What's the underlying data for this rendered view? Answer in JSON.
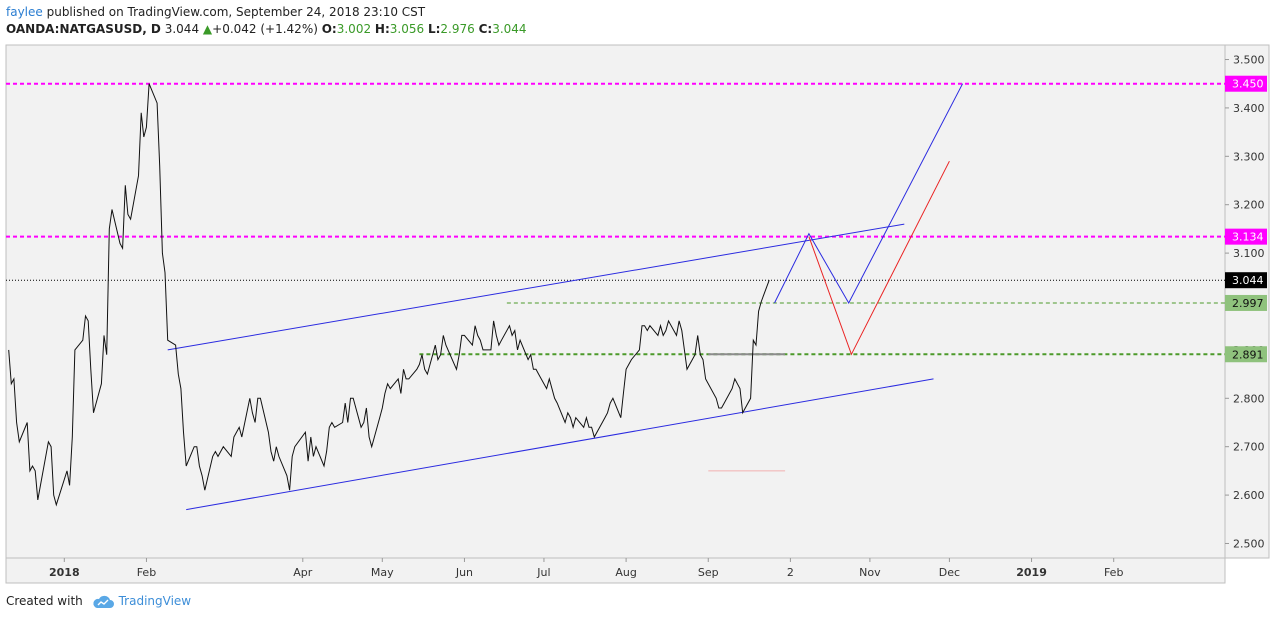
{
  "header": {
    "author": "faylee",
    "published_text": " published on TradingView.com, September 24, 2018 23:10 CST",
    "symbol": "OANDA:NATGASUSD, D",
    "last": "3.044",
    "change_icon": "triangle-up-icon",
    "change": "+0.042 (+1.42%)",
    "open_label": "O:",
    "open": "3.002",
    "high_label": "H:",
    "high": "3.056",
    "low_label": "L:",
    "low": "2.976",
    "close_label": "C:",
    "close": "3.044"
  },
  "footer": {
    "created_with": "Created with",
    "brand": "TradingView",
    "brand_icon": "tradingview-cloud-icon"
  },
  "colors": {
    "plot_bg": "#f2f2f2",
    "price_line": "#111111",
    "channel": "#2b2be0",
    "projection_blue": "#2b2be0",
    "projection_red": "#ea2323",
    "resistance": "#ff00ff",
    "support": "#4c9a2a",
    "support_label_bg": "#8fc27d",
    "current_price_bg": "#000000"
  },
  "chart_data": {
    "type": "line",
    "title": "",
    "xlabel": "",
    "ylabel": "",
    "ylim": [
      2.47,
      3.53
    ],
    "y_ticks": [
      "2.500",
      "2.600",
      "2.700",
      "2.800",
      "2.900",
      "3.000",
      "3.100",
      "3.200",
      "3.300",
      "3.400",
      "3.500"
    ],
    "x_ticks": [
      {
        "label": "2018",
        "date": "2018-01-01",
        "bold": true
      },
      {
        "label": "Feb",
        "date": "2018-02-01"
      },
      {
        "label": "Apr",
        "date": "2018-04-01"
      },
      {
        "label": "May",
        "date": "2018-05-01"
      },
      {
        "label": "Jun",
        "date": "2018-06-01"
      },
      {
        "label": "Jul",
        "date": "2018-07-01"
      },
      {
        "label": "Aug",
        "date": "2018-08-01"
      },
      {
        "label": "Sep",
        "date": "2018-09-01"
      },
      {
        "label": "2",
        "date": "2018-10-02"
      },
      {
        "label": "Nov",
        "date": "2018-11-01"
      },
      {
        "label": "Dec",
        "date": "2018-12-01"
      },
      {
        "label": "2019",
        "date": "2019-01-01",
        "bold": true
      },
      {
        "label": "Feb",
        "date": "2019-02-01"
      }
    ],
    "x_range": [
      "2017-12-10",
      "2019-03-15"
    ],
    "series": [
      {
        "values": [
          [
            "2017-12-11",
            2.9
          ],
          [
            "2017-12-12",
            2.83
          ],
          [
            "2017-12-13",
            2.84
          ],
          [
            "2017-12-14",
            2.75
          ],
          [
            "2017-12-15",
            2.71
          ],
          [
            "2017-12-18",
            2.75
          ],
          [
            "2017-12-19",
            2.65
          ],
          [
            "2017-12-20",
            2.66
          ],
          [
            "2017-12-21",
            2.65
          ],
          [
            "2017-12-22",
            2.59
          ],
          [
            "2017-12-26",
            2.71
          ],
          [
            "2017-12-27",
            2.7
          ],
          [
            "2017-12-28",
            2.6
          ],
          [
            "2017-12-29",
            2.58
          ],
          [
            "2018-01-02",
            2.65
          ],
          [
            "2018-01-03",
            2.62
          ],
          [
            "2018-01-04",
            2.72
          ],
          [
            "2018-01-05",
            2.9
          ],
          [
            "2018-01-08",
            2.92
          ],
          [
            "2018-01-09",
            2.97
          ],
          [
            "2018-01-10",
            2.96
          ],
          [
            "2018-01-11",
            2.86
          ],
          [
            "2018-01-12",
            2.77
          ],
          [
            "2018-01-15",
            2.83
          ],
          [
            "2018-01-16",
            2.93
          ],
          [
            "2018-01-17",
            2.89
          ],
          [
            "2018-01-18",
            3.15
          ],
          [
            "2018-01-19",
            3.19
          ],
          [
            "2018-01-22",
            3.12
          ],
          [
            "2018-01-23",
            3.11
          ],
          [
            "2018-01-24",
            3.24
          ],
          [
            "2018-01-25",
            3.18
          ],
          [
            "2018-01-26",
            3.17
          ],
          [
            "2018-01-29",
            3.26
          ],
          [
            "2018-01-30",
            3.39
          ],
          [
            "2018-01-31",
            3.34
          ],
          [
            "2018-02-01",
            3.36
          ],
          [
            "2018-02-02",
            3.45
          ],
          [
            "2018-02-05",
            3.41
          ],
          [
            "2018-02-06",
            3.28
          ],
          [
            "2018-02-07",
            3.1
          ],
          [
            "2018-02-08",
            3.06
          ],
          [
            "2018-02-09",
            2.92
          ],
          [
            "2018-02-12",
            2.91
          ],
          [
            "2018-02-13",
            2.85
          ],
          [
            "2018-02-14",
            2.82
          ],
          [
            "2018-02-15",
            2.73
          ],
          [
            "2018-02-16",
            2.66
          ],
          [
            "2018-02-19",
            2.7
          ],
          [
            "2018-02-20",
            2.7
          ],
          [
            "2018-02-21",
            2.66
          ],
          [
            "2018-02-22",
            2.64
          ],
          [
            "2018-02-23",
            2.61
          ],
          [
            "2018-02-26",
            2.68
          ],
          [
            "2018-02-27",
            2.69
          ],
          [
            "2018-02-28",
            2.68
          ],
          [
            "2018-03-01",
            2.69
          ],
          [
            "2018-03-02",
            2.7
          ],
          [
            "2018-03-05",
            2.68
          ],
          [
            "2018-03-06",
            2.72
          ],
          [
            "2018-03-07",
            2.73
          ],
          [
            "2018-03-08",
            2.74
          ],
          [
            "2018-03-09",
            2.72
          ],
          [
            "2018-03-12",
            2.8
          ],
          [
            "2018-03-13",
            2.77
          ],
          [
            "2018-03-14",
            2.75
          ],
          [
            "2018-03-15",
            2.8
          ],
          [
            "2018-03-16",
            2.8
          ],
          [
            "2018-03-19",
            2.73
          ],
          [
            "2018-03-20",
            2.69
          ],
          [
            "2018-03-21",
            2.67
          ],
          [
            "2018-03-22",
            2.7
          ],
          [
            "2018-03-23",
            2.68
          ],
          [
            "2018-03-26",
            2.64
          ],
          [
            "2018-03-27",
            2.61
          ],
          [
            "2018-03-28",
            2.68
          ],
          [
            "2018-03-29",
            2.7
          ],
          [
            "2018-04-02",
            2.73
          ],
          [
            "2018-04-03",
            2.67
          ],
          [
            "2018-04-04",
            2.72
          ],
          [
            "2018-04-05",
            2.68
          ],
          [
            "2018-04-06",
            2.7
          ],
          [
            "2018-04-09",
            2.66
          ],
          [
            "2018-04-10",
            2.69
          ],
          [
            "2018-04-11",
            2.74
          ],
          [
            "2018-04-12",
            2.75
          ],
          [
            "2018-04-13",
            2.74
          ],
          [
            "2018-04-16",
            2.75
          ],
          [
            "2018-04-17",
            2.79
          ],
          [
            "2018-04-18",
            2.75
          ],
          [
            "2018-04-19",
            2.8
          ],
          [
            "2018-04-20",
            2.8
          ],
          [
            "2018-04-23",
            2.74
          ],
          [
            "2018-04-24",
            2.75
          ],
          [
            "2018-04-25",
            2.78
          ],
          [
            "2018-04-26",
            2.72
          ],
          [
            "2018-04-27",
            2.7
          ],
          [
            "2018-04-30",
            2.76
          ],
          [
            "2018-05-01",
            2.78
          ],
          [
            "2018-05-02",
            2.81
          ],
          [
            "2018-05-03",
            2.83
          ],
          [
            "2018-05-04",
            2.82
          ],
          [
            "2018-05-07",
            2.84
          ],
          [
            "2018-05-08",
            2.81
          ],
          [
            "2018-05-09",
            2.86
          ],
          [
            "2018-05-10",
            2.84
          ],
          [
            "2018-05-11",
            2.84
          ],
          [
            "2018-05-14",
            2.86
          ],
          [
            "2018-05-15",
            2.87
          ],
          [
            "2018-05-16",
            2.89
          ],
          [
            "2018-05-17",
            2.86
          ],
          [
            "2018-05-18",
            2.85
          ],
          [
            "2018-05-21",
            2.91
          ],
          [
            "2018-05-22",
            2.88
          ],
          [
            "2018-05-23",
            2.89
          ],
          [
            "2018-05-24",
            2.93
          ],
          [
            "2018-05-25",
            2.91
          ],
          [
            "2018-05-29",
            2.86
          ],
          [
            "2018-05-30",
            2.89
          ],
          [
            "2018-05-31",
            2.93
          ],
          [
            "2018-06-01",
            2.93
          ],
          [
            "2018-06-04",
            2.91
          ],
          [
            "2018-06-05",
            2.95
          ],
          [
            "2018-06-06",
            2.93
          ],
          [
            "2018-06-07",
            2.92
          ],
          [
            "2018-06-08",
            2.9
          ],
          [
            "2018-06-11",
            2.9
          ],
          [
            "2018-06-12",
            2.96
          ],
          [
            "2018-06-13",
            2.93
          ],
          [
            "2018-06-14",
            2.91
          ],
          [
            "2018-06-15",
            2.92
          ],
          [
            "2018-06-18",
            2.95
          ],
          [
            "2018-06-19",
            2.93
          ],
          [
            "2018-06-20",
            2.94
          ],
          [
            "2018-06-21",
            2.9
          ],
          [
            "2018-06-22",
            2.92
          ],
          [
            "2018-06-25",
            2.88
          ],
          [
            "2018-06-26",
            2.89
          ],
          [
            "2018-06-27",
            2.86
          ],
          [
            "2018-06-28",
            2.86
          ],
          [
            "2018-06-29",
            2.85
          ],
          [
            "2018-07-02",
            2.82
          ],
          [
            "2018-07-03",
            2.84
          ],
          [
            "2018-07-05",
            2.8
          ],
          [
            "2018-07-06",
            2.79
          ],
          [
            "2018-07-09",
            2.75
          ],
          [
            "2018-07-10",
            2.77
          ],
          [
            "2018-07-11",
            2.76
          ],
          [
            "2018-07-12",
            2.74
          ],
          [
            "2018-07-13",
            2.76
          ],
          [
            "2018-07-16",
            2.74
          ],
          [
            "2018-07-17",
            2.76
          ],
          [
            "2018-07-18",
            2.74
          ],
          [
            "2018-07-19",
            2.74
          ],
          [
            "2018-07-20",
            2.72
          ],
          [
            "2018-07-23",
            2.75
          ],
          [
            "2018-07-24",
            2.76
          ],
          [
            "2018-07-25",
            2.77
          ],
          [
            "2018-07-26",
            2.79
          ],
          [
            "2018-07-27",
            2.8
          ],
          [
            "2018-07-30",
            2.76
          ],
          [
            "2018-07-31",
            2.81
          ],
          [
            "2018-08-01",
            2.86
          ],
          [
            "2018-08-02",
            2.87
          ],
          [
            "2018-08-03",
            2.88
          ],
          [
            "2018-08-06",
            2.9
          ],
          [
            "2018-08-07",
            2.95
          ],
          [
            "2018-08-08",
            2.95
          ],
          [
            "2018-08-09",
            2.94
          ],
          [
            "2018-08-10",
            2.95
          ],
          [
            "2018-08-13",
            2.93
          ],
          [
            "2018-08-14",
            2.95
          ],
          [
            "2018-08-15",
            2.93
          ],
          [
            "2018-08-16",
            2.94
          ],
          [
            "2018-08-17",
            2.96
          ],
          [
            "2018-08-20",
            2.93
          ],
          [
            "2018-08-21",
            2.96
          ],
          [
            "2018-08-22",
            2.94
          ],
          [
            "2018-08-23",
            2.9
          ],
          [
            "2018-08-24",
            2.86
          ],
          [
            "2018-08-27",
            2.89
          ],
          [
            "2018-08-28",
            2.93
          ],
          [
            "2018-08-29",
            2.89
          ],
          [
            "2018-08-30",
            2.88
          ],
          [
            "2018-08-31",
            2.84
          ],
          [
            "2018-09-04",
            2.8
          ],
          [
            "2018-09-05",
            2.78
          ],
          [
            "2018-09-06",
            2.78
          ],
          [
            "2018-09-07",
            2.79
          ],
          [
            "2018-09-10",
            2.82
          ],
          [
            "2018-09-11",
            2.84
          ],
          [
            "2018-09-12",
            2.83
          ],
          [
            "2018-09-13",
            2.82
          ],
          [
            "2018-09-14",
            2.77
          ],
          [
            "2018-09-17",
            2.8
          ],
          [
            "2018-09-18",
            2.92
          ],
          [
            "2018-09-19",
            2.91
          ],
          [
            "2018-09-20",
            2.98
          ],
          [
            "2018-09-21",
            3.0
          ],
          [
            "2018-09-24",
            3.044
          ]
        ]
      }
    ],
    "drawings": {
      "channel_upper": [
        [
          "2018-02-09",
          2.9
        ],
        [
          "2018-11-14",
          3.16
        ]
      ],
      "channel_lower": [
        [
          "2018-02-16",
          2.57
        ],
        [
          "2018-11-25",
          2.84
        ]
      ],
      "projection_blue": [
        [
          "2018-09-26",
          2.997
        ],
        [
          "2018-10-09",
          3.14
        ],
        [
          "2018-10-24",
          2.997
        ],
        [
          "2018-12-06",
          3.45
        ]
      ],
      "projection_red": [
        [
          "2018-10-09",
          3.134
        ],
        [
          "2018-10-25",
          2.891
        ],
        [
          "2018-12-01",
          3.29
        ]
      ],
      "resistance_upper": {
        "value": 3.45,
        "label": "3.450"
      },
      "resistance_lower": {
        "value": 3.134,
        "label": "3.134"
      },
      "support_upper": {
        "value": 2.997,
        "label": "2.997",
        "from": "2018-06-17"
      },
      "support_lower": {
        "value": 2.891,
        "label": "2.891",
        "from": "2018-05-15"
      },
      "current_price": {
        "value": 3.044,
        "label": "3.044"
      },
      "gray_segment": [
        [
          "2018-09-01",
          2.891
        ],
        [
          "2018-09-30",
          2.891
        ]
      ],
      "pink_segment": [
        [
          "2018-09-01",
          2.65
        ],
        [
          "2018-09-30",
          2.65
        ]
      ]
    }
  }
}
